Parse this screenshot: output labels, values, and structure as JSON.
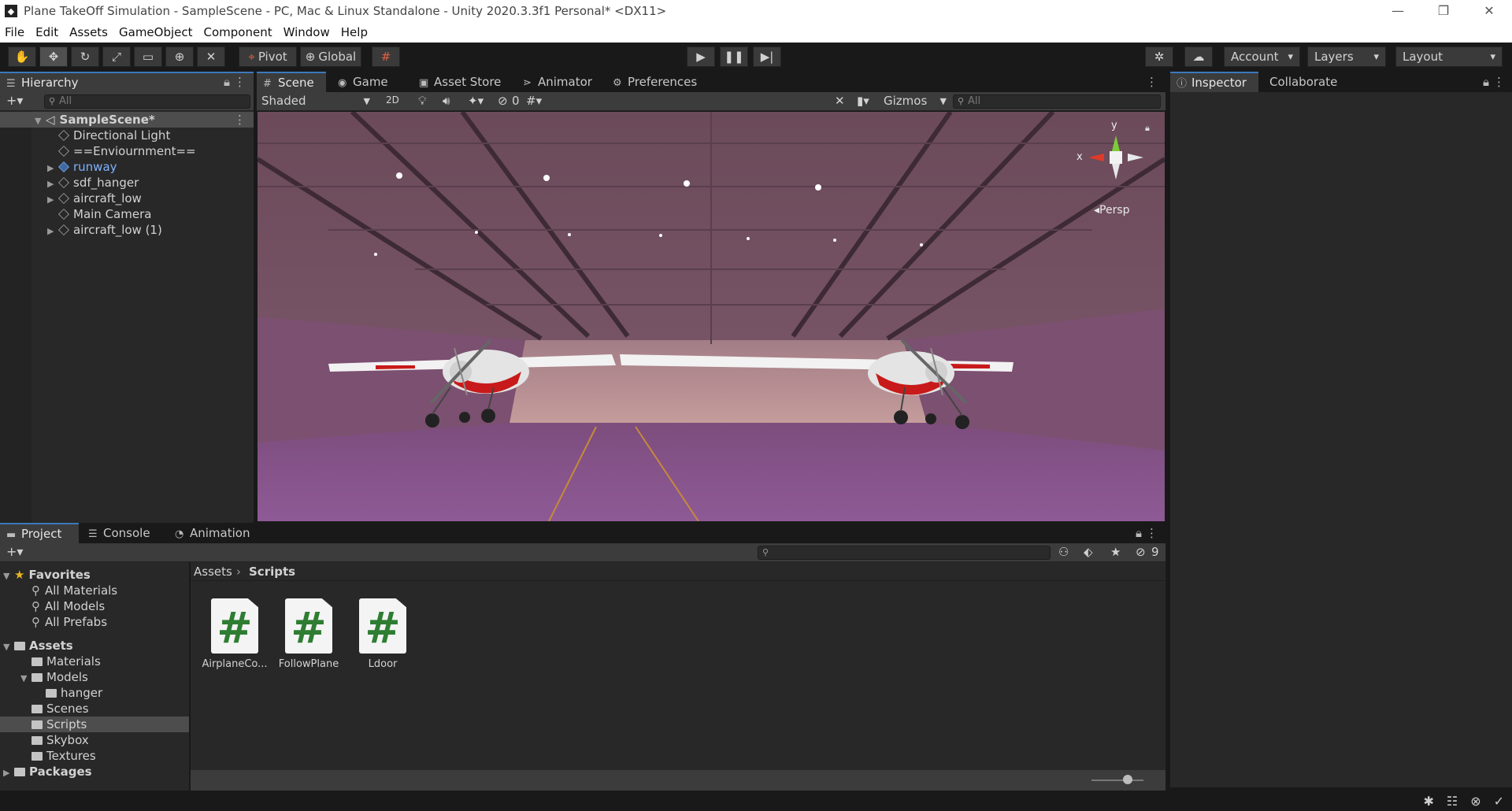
{
  "window": {
    "title": "Plane TakeOff Simulation - SampleScene - PC, Mac & Linux Standalone - Unity 2020.3.3f1 Personal* <DX11>",
    "minimize": "—",
    "maximize": "❐",
    "close": "✕"
  },
  "menu": [
    "File",
    "Edit",
    "Assets",
    "GameObject",
    "Component",
    "Window",
    "Help"
  ],
  "toolbar": {
    "pivot_label": "Pivot",
    "global_label": "Global",
    "account_label": "Account",
    "layers_label": "Layers",
    "layout_label": "Layout"
  },
  "hierarchy": {
    "tab_label": "Hierarchy",
    "search_placeholder": "All",
    "scene_name": "SampleScene*",
    "items": [
      {
        "label": "Directional Light",
        "expandable": false
      },
      {
        "label": "==Enviournment==",
        "expandable": false
      },
      {
        "label": "runway",
        "expandable": true
      },
      {
        "label": "sdf_hanger",
        "expandable": true
      },
      {
        "label": "aircraft_low",
        "expandable": true
      },
      {
        "label": "Main Camera",
        "expandable": false
      },
      {
        "label": "aircraft_low (1)",
        "expandable": true
      }
    ]
  },
  "scene_tabs": [
    "Scene",
    "Game",
    "Asset Store",
    "Animator",
    "Preferences"
  ],
  "scene_toolbar": {
    "shading_mode": "Shaded",
    "mode_2d": "2D",
    "hidden_count": "0",
    "gizmos_label": "Gizmos",
    "search_placeholder": "All"
  },
  "gizmo": {
    "y_label": "y",
    "x_label": "x",
    "persp_label": "Persp"
  },
  "inspector": {
    "tab_label": "Inspector",
    "collab_label": "Collaborate"
  },
  "bottom_tabs": [
    "Project",
    "Console",
    "Animation"
  ],
  "project": {
    "hidden_count": "9",
    "breadcrumb_root": "Assets",
    "breadcrumb_current": "Scripts",
    "favorites_label": "Favorites",
    "favorites": [
      "All Materials",
      "All Models",
      "All Prefabs"
    ],
    "assets_label": "Assets",
    "assets_folders": [
      "Materials",
      "Models",
      "hanger",
      "Scenes",
      "Scripts",
      "Skybox",
      "Textures"
    ],
    "packages_label": "Packages",
    "files": [
      {
        "name": "AirplaneCo..."
      },
      {
        "name": "FollowPlane"
      },
      {
        "name": "Ldoor"
      }
    ],
    "file_glyph": "#"
  },
  "colors": {
    "accent": "#3a79bb",
    "selected_row": "#4d4d4d",
    "prefab_blue": "#7fb2ff",
    "hangar_purple": "#8a5a8a"
  }
}
